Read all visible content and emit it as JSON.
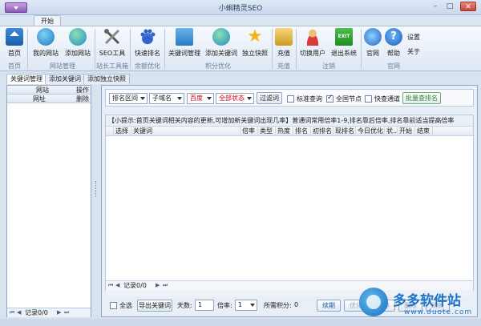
{
  "window": {
    "title": "小蝌精灵SEO",
    "controls": {
      "minimize": "–",
      "maximize": "□",
      "close": "✕"
    }
  },
  "ribbon": {
    "tab": "开始",
    "buttons": [
      {
        "label": "首页",
        "icon": "home-icon"
      },
      {
        "label": "我的网站",
        "icon": "globe-icon"
      },
      {
        "label": "添加网站",
        "icon": "globe-plus-icon"
      },
      {
        "label": "SEO工具",
        "icon": "tools-icon"
      },
      {
        "label": "快速排名",
        "icon": "paw-icon"
      },
      {
        "label": "关键词管理",
        "icon": "network-icon"
      },
      {
        "label": "添加关键词",
        "icon": "globe-plus-icon"
      },
      {
        "label": "独立快照",
        "icon": "star-icon"
      },
      {
        "label": "充值",
        "icon": "money-icon"
      },
      {
        "label": "切换用户",
        "icon": "user-icon"
      },
      {
        "label": "退出系统",
        "icon": "exit-icon",
        "icon_text": "EXIT"
      },
      {
        "label": "官网",
        "icon": "ie-icon"
      },
      {
        "label": "帮助",
        "icon": "help-icon",
        "icon_text": "?"
      },
      {
        "label": "设置",
        "icon": "none"
      },
      {
        "label": "关于",
        "icon": "none"
      }
    ],
    "groups": [
      "首页",
      "网站管理",
      "站长工具箱",
      "余额优化",
      "积分优化",
      "充值",
      "注销",
      "官网"
    ]
  },
  "panel_tabs": [
    "关键词管理",
    "添加关键词",
    "添加独立快照"
  ],
  "left_panel": {
    "header_row1": {
      "col1": "网站",
      "col2": "操作"
    },
    "header_row2": {
      "col1": "网址",
      "col2": "删除"
    },
    "footer": "记录0/0"
  },
  "filters": {
    "sort": "排名区间",
    "sub_domain": "子域名",
    "engine": "百度",
    "status": "全部状态",
    "filter_button": "过滤词",
    "checkbox_precise": "标准查询",
    "checkbox_all_nodes": "全国节点",
    "checkbox_fast": "快查通道",
    "batch_button": "批量查排名",
    "accent_red": "#d0021b",
    "accent_green": "#2e8b2e"
  },
  "grid": {
    "tip": "【小提示:首页关键词相关内容的更新,可增加新关键词出现几率】普通词常用倍率1-9,排名靠后倍率,排名靠前适当提高倍率",
    "columns": [
      "选择",
      "关键词",
      "倍率",
      "类型",
      "热度",
      "排名",
      "初排名",
      "现排名",
      "今日优化",
      "状...",
      "开始",
      "结束"
    ],
    "footer": "记录0/0"
  },
  "bottom": {
    "select_all": "全选",
    "export": "导出关键词",
    "days_label": "天数:",
    "days_value": "1",
    "rate_label": "倍率:",
    "rate_value": "1",
    "points_label": "所需积分:",
    "points_value": "0",
    "continue": "续期",
    "optimize": "优化",
    "pause": "暂停",
    "delete": "删除",
    "refresh": "刷新"
  },
  "watermark": {
    "name": "多多软件站",
    "url": "www.duote.com"
  }
}
